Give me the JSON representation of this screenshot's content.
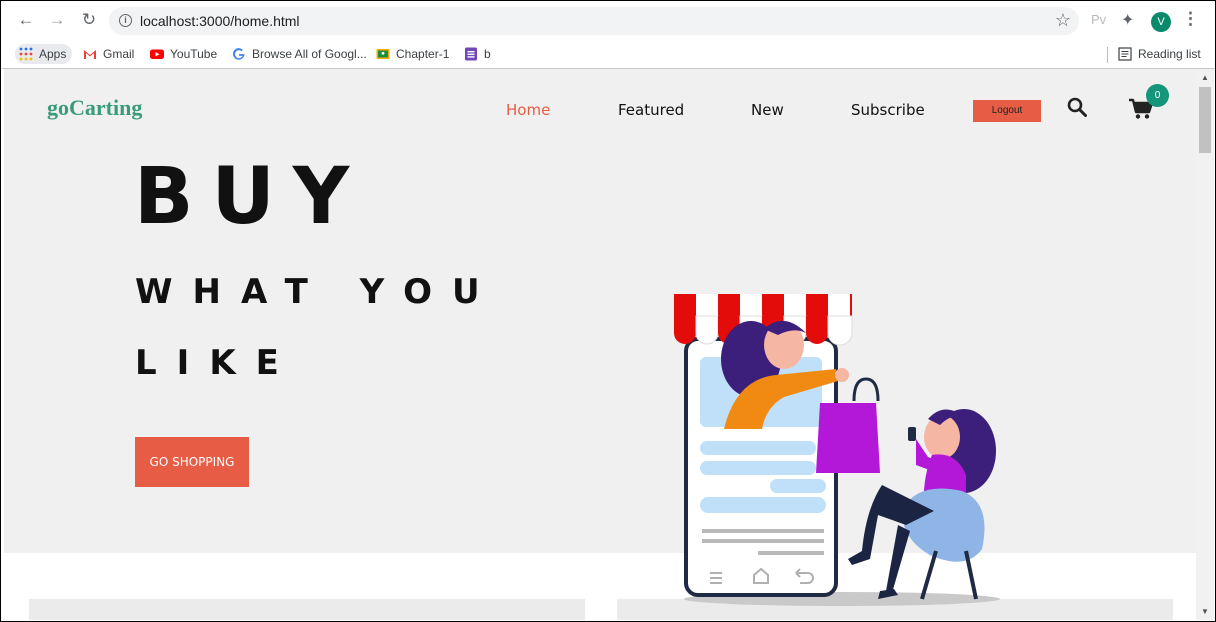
{
  "browser": {
    "url": "localhost:3000/home.html",
    "ext_label": "Pv",
    "profile_initial": "V",
    "bookmarks": [
      {
        "label": "Apps"
      },
      {
        "label": "Gmail"
      },
      {
        "label": "YouTube"
      },
      {
        "label": "Browse All of Googl..."
      },
      {
        "label": "Chapter-1"
      },
      {
        "label": "b"
      }
    ],
    "reading_list": "Reading list"
  },
  "site": {
    "logo": "goCarting",
    "nav": {
      "home": "Home",
      "featured": "Featured",
      "new": "New",
      "subscribe": "Subscribe",
      "logout": "Logout"
    },
    "cart_count": "0"
  },
  "hero": {
    "line1": "BUY",
    "line2": "WHAT YOU",
    "line3": "LIKE",
    "cta": "GO SHOPPING"
  },
  "colors": {
    "accent": "#e65c45",
    "brand": "#3a9b79",
    "badge": "#15957a",
    "hero_bg": "#f0f0f1"
  },
  "icons": [
    "back-arrow-icon",
    "forward-arrow-icon",
    "reload-icon",
    "info-icon",
    "star-icon",
    "puzzle-icon",
    "menu-dots-icon",
    "search-icon",
    "cart-icon"
  ]
}
